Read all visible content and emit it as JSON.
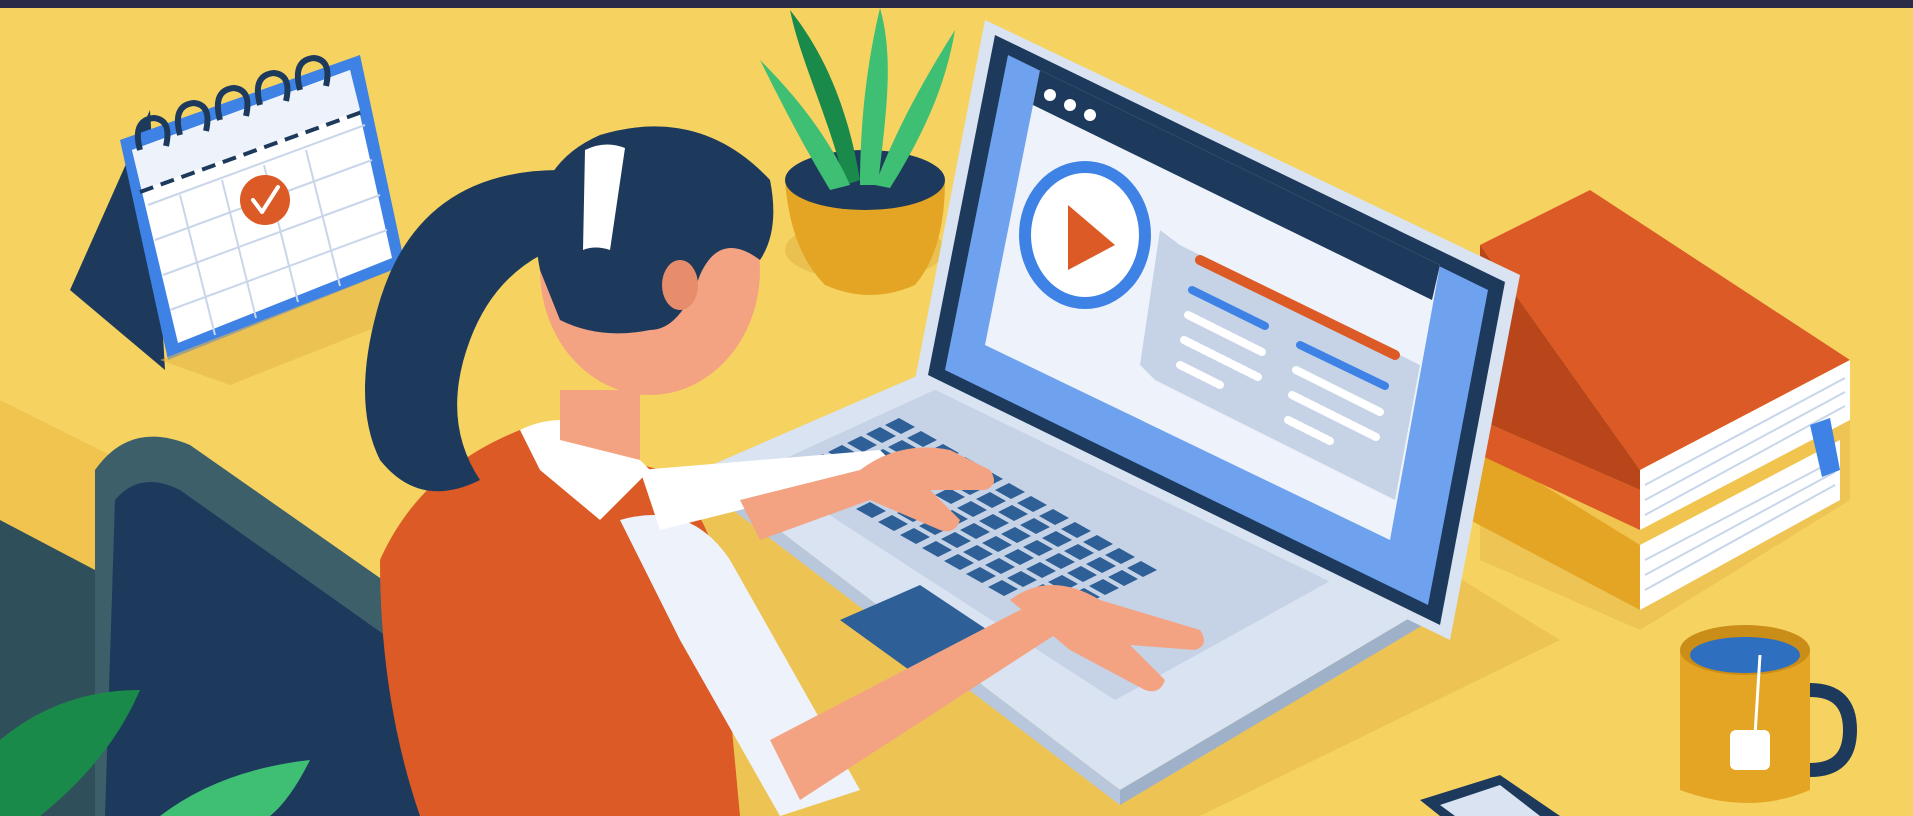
{
  "colors": {
    "top_bar": "#2b2b45",
    "background": "#f6d360",
    "shadow": "#e6b84a",
    "navy": "#1d3a5c",
    "orange": "#dc5a25",
    "skin": "#f3a382",
    "white": "#ffffff",
    "laptop_body": "#d9e3f1",
    "screen_bezel": "#1d3a5c",
    "screen_blue": "#6ea2ef",
    "accent_blue": "#3f82e6",
    "plant_green": "#3fbf73",
    "plant_dark": "#1a8a4a",
    "mustard": "#e5a524",
    "chair": "#3d5f6a"
  },
  "icons": {
    "play": "play-icon",
    "check": "check-icon"
  }
}
